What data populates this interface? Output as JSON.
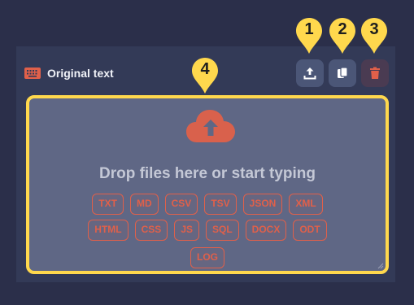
{
  "header": {
    "title": "Original text",
    "icon": "keyboard-icon"
  },
  "toolbar": {
    "buttons": [
      {
        "name": "upload",
        "icon": "upload-icon"
      },
      {
        "name": "copy",
        "icon": "copy-icon"
      },
      {
        "name": "delete",
        "icon": "trash-icon"
      }
    ]
  },
  "callouts": [
    "1",
    "2",
    "3",
    "4"
  ],
  "dropzone": {
    "icon": "cloud-upload-icon",
    "prompt": "Drop files here or start typing",
    "formats_row1": [
      "TXT",
      "MD",
      "CSV",
      "TSV",
      "JSON",
      "XML"
    ],
    "formats_row2": [
      "HTML",
      "CSS",
      "JS",
      "SQL",
      "DOCX",
      "ODT"
    ],
    "formats_row3": [
      "LOG"
    ]
  },
  "colors": {
    "background": "#2b2f4a",
    "panel": "#333a57",
    "accent": "#e0604a",
    "highlight": "#ffd84d"
  }
}
